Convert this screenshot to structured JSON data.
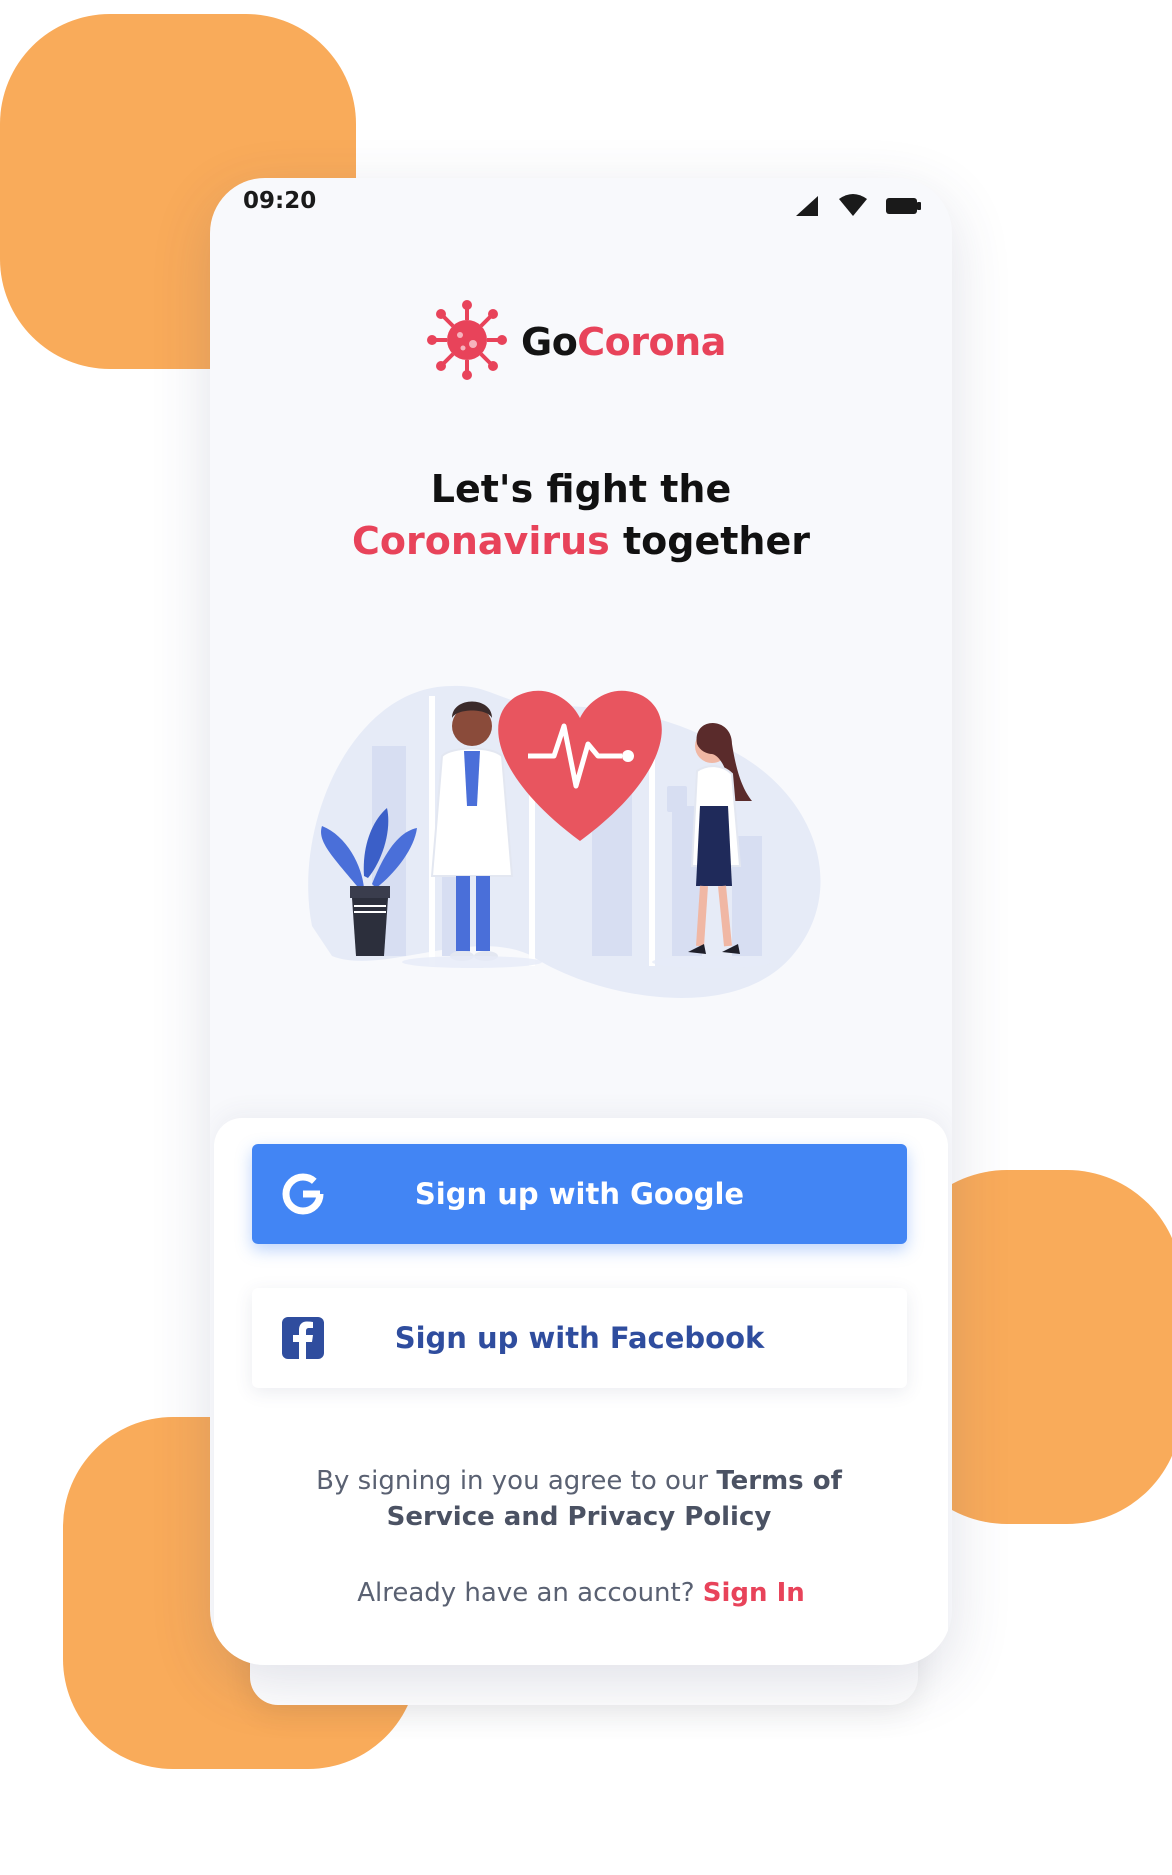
{
  "status_bar": {
    "time": "09:20"
  },
  "brand": {
    "part1": "Go",
    "part2": "Corona"
  },
  "headline": {
    "line1": "Let's fight the",
    "highlight": "Coronavirus",
    "rest": "together"
  },
  "buttons": {
    "google": "Sign up with Google",
    "facebook": "Sign up with Facebook"
  },
  "terms": {
    "prefix": "By signing in you agree to our",
    "link": "Terms of Service and Privacy Policy"
  },
  "signin": {
    "prompt": "Already have an account?",
    "link": "Sign In"
  },
  "colors": {
    "accent_red": "#e8435a",
    "google_blue": "#4285f4",
    "facebook_blue": "#3b5998",
    "blob_orange": "#f9ab5a"
  },
  "icons": [
    "coronavirus-logo-icon",
    "signal-icon",
    "wifi-icon",
    "battery-icon",
    "google-icon",
    "facebook-icon",
    "heartbeat-icon"
  ]
}
